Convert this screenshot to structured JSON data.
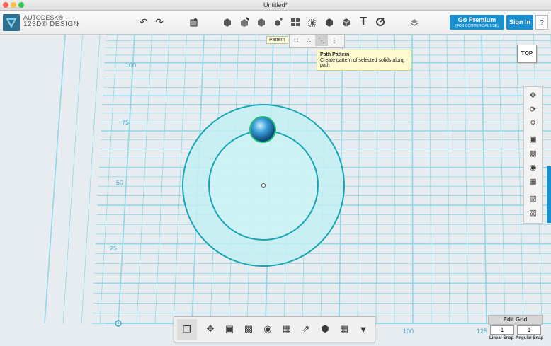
{
  "window": {
    "title": "Untitled*"
  },
  "brand": {
    "line1": "AUTODESK®",
    "line2": "123D® DESIGN"
  },
  "toolbar": {
    "icons": [
      "undo-icon",
      "redo-icon",
      "primitives-icon",
      "sketch-icon",
      "construct-icon",
      "modify-icon",
      "pattern-icon",
      "grouping-icon",
      "combine-icon",
      "measure-icon",
      "text-icon",
      "snap-icon",
      "material-icon"
    ],
    "text_tool_glyph": "T",
    "go_premium": "Go Premium",
    "go_premium_sub": "(FOR COMMERCIAL USE)",
    "sign_in": "Sign In",
    "help": "?"
  },
  "pattern_menu": {
    "label": "Pattern",
    "tooltip_title": "Path Pattern",
    "tooltip_desc": "Create pattern of selected solids along path"
  },
  "viewcube": {
    "face": "TOP"
  },
  "grid_labels": {
    "y": [
      "100",
      "75",
      "50",
      "25"
    ],
    "x": [
      "100",
      "125"
    ]
  },
  "grid_editor": {
    "edit_grid": "Edit Grid",
    "linear_snap_value": "1",
    "angular_snap_value": "1",
    "linear_snap_label": "Linear Snap",
    "angular_snap_label": "Angular Snap"
  },
  "colors": {
    "accent": "#1a8fd0",
    "grid_line": "#7fd3e4",
    "solid_fill": "#bfeff1",
    "solid_stroke": "#12a0b0"
  }
}
